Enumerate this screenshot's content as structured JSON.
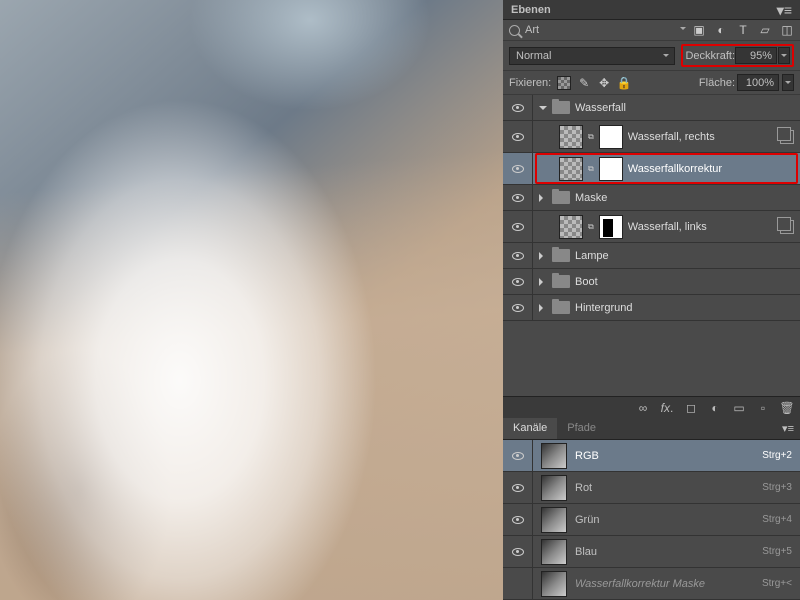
{
  "panel_title": "Ebenen",
  "search_label": "Art",
  "blend_mode": "Normal",
  "opacity": {
    "label": "Deckkraft:",
    "value": "95%"
  },
  "lock_label": "Fixieren:",
  "fill": {
    "label": "Fläche:",
    "value": "100%"
  },
  "layers": [
    {
      "type": "group",
      "name": "Wasserfall",
      "open": true,
      "indent": 0
    },
    {
      "type": "layer",
      "name": "Wasserfall, rechts",
      "indent": 1,
      "mask": "white",
      "stack": true
    },
    {
      "type": "layer",
      "name": "Wasserfallkorrektur",
      "indent": 1,
      "mask": "white",
      "selected": true,
      "highlight": true
    },
    {
      "type": "group",
      "name": "Maske",
      "open": false,
      "indent": 0
    },
    {
      "type": "layer",
      "name": "Wasserfall, links",
      "indent": 1,
      "mask": "shape",
      "stack": true
    },
    {
      "type": "group",
      "name": "Lampe",
      "open": false,
      "indent": 0
    },
    {
      "type": "group",
      "name": "Boot",
      "open": false,
      "indent": 0
    },
    {
      "type": "group",
      "name": "Hintergrund",
      "open": false,
      "indent": 0
    }
  ],
  "channels_tab": "Kanäle",
  "paths_tab": "Pfade",
  "channels": [
    {
      "name": "RGB",
      "shortcut": "Strg+2",
      "selected": true
    },
    {
      "name": "Rot",
      "shortcut": "Strg+3"
    },
    {
      "name": "Grün",
      "shortcut": "Strg+4"
    },
    {
      "name": "Blau",
      "shortcut": "Strg+5"
    },
    {
      "name": "Wasserfallkorrektur Maske",
      "shortcut": "Strg+<",
      "ital": true,
      "novis": true
    }
  ],
  "footer_icons": [
    "link",
    "fx",
    "mask",
    "adj",
    "group",
    "new",
    "trash"
  ]
}
